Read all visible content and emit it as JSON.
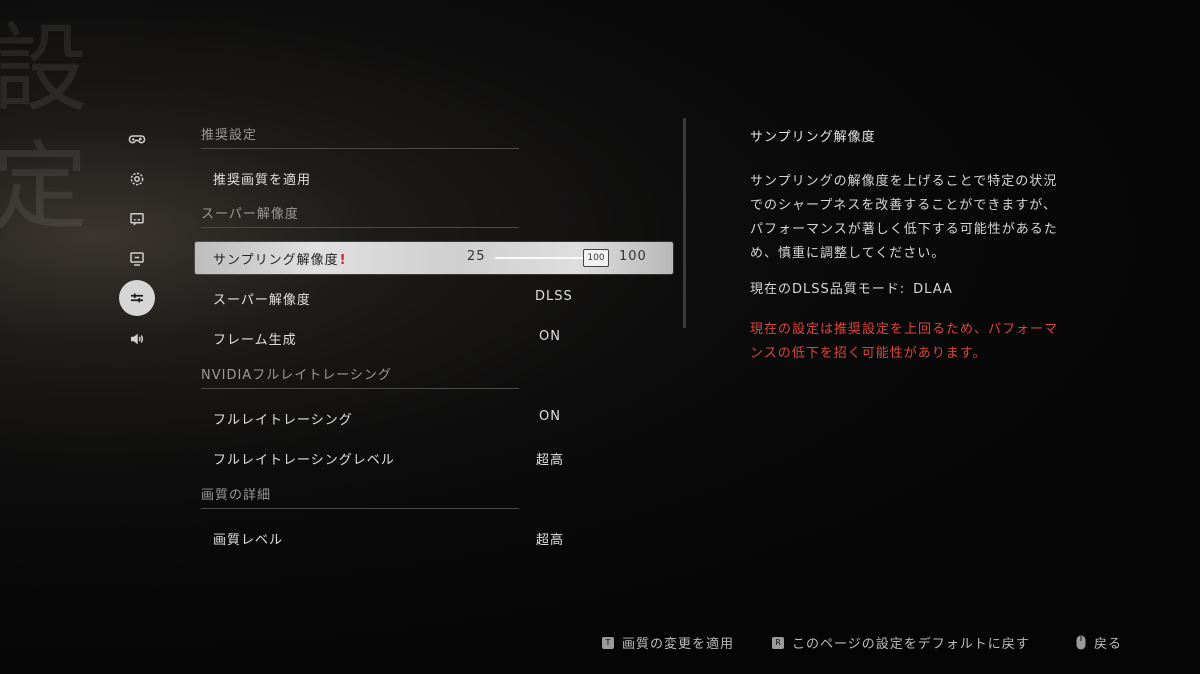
{
  "background": {
    "glyphs": [
      "設",
      "定"
    ]
  },
  "rail": {
    "items": [
      {
        "icon": "gamepad-icon",
        "active": false
      },
      {
        "icon": "gear-icon",
        "active": false
      },
      {
        "icon": "subtitles-icon",
        "active": false
      },
      {
        "icon": "monitor-icon",
        "active": false
      },
      {
        "icon": "sliders-icon",
        "active": true
      },
      {
        "icon": "speaker-icon",
        "active": false
      }
    ]
  },
  "settings": {
    "sections": [
      {
        "title": "推奨設定"
      },
      {
        "title": "スーパー解像度"
      },
      {
        "title": "NVIDIAフルレイトレーシング"
      },
      {
        "title": "画質の詳細"
      }
    ],
    "rows": [
      {
        "label": "推奨画質を適用",
        "value": ""
      },
      {
        "label": "サンプリング解像度",
        "warning_mark": "!",
        "slider": {
          "min": "25",
          "max": "100",
          "current": "100"
        }
      },
      {
        "label": "スーパー解像度",
        "value": "DLSS"
      },
      {
        "label": "フレーム生成",
        "value": "ON"
      },
      {
        "label": "フルレイトレーシング",
        "value": "ON"
      },
      {
        "label": "フルレイトレーシングレベル",
        "value": "超高"
      },
      {
        "label": "画質レベル",
        "value": "超高"
      }
    ]
  },
  "detail": {
    "title": "サンプリング解像度",
    "description": "サンプリングの解像度を上げることで特定の状況でのシャープネスを改善することができますが、パフォーマンスが著しく低下する可能性があるため、慎重に調整してください。",
    "mode_label": "現在のDLSS品質モード:",
    "mode_value": "DLAA",
    "warning": "現在の設定は推奨設定を上回るため、パフォーマンスの低下を招く可能性があります。"
  },
  "footer": {
    "hints": [
      {
        "key": "T",
        "label": "画質の変更を適用"
      },
      {
        "key": "R",
        "label": "このページの設定をデフォルトに戻す"
      },
      {
        "key": "mouse",
        "label": "戻る"
      }
    ]
  },
  "colors": {
    "warning": "#d9453e",
    "warning_mark": "#c8262a",
    "selected_row": "#d4d4d4"
  }
}
